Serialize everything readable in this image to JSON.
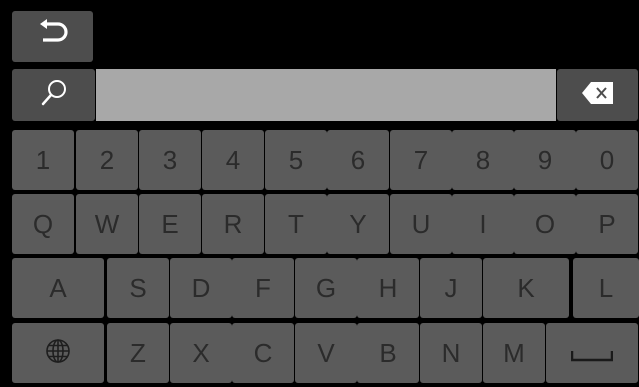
{
  "header": {
    "back_icon": "undo-arrow-icon"
  },
  "search": {
    "icon": "search-icon",
    "value": "",
    "clear_icon": "backspace-icon"
  },
  "keyboard": {
    "row1": [
      "1",
      "2",
      "3",
      "4",
      "5",
      "6",
      "7",
      "8",
      "9",
      "0"
    ],
    "row2": [
      "Q",
      "W",
      "E",
      "R",
      "T",
      "Y",
      "U",
      "I",
      "O",
      "P"
    ],
    "row3": [
      "A",
      "S",
      "D",
      "F",
      "G",
      "H",
      "J",
      "K",
      "L"
    ],
    "row4_letters": [
      "Z",
      "X",
      "C",
      "V",
      "B",
      "N",
      "M"
    ],
    "globe_icon": "globe-icon",
    "space_icon": "space-bar-icon"
  },
  "colors": {
    "background": "#000000",
    "key": "#5b5b5b",
    "key_label": "#2b2b2b",
    "search_field": "#a8a8a8",
    "icon": "#ffffff"
  }
}
